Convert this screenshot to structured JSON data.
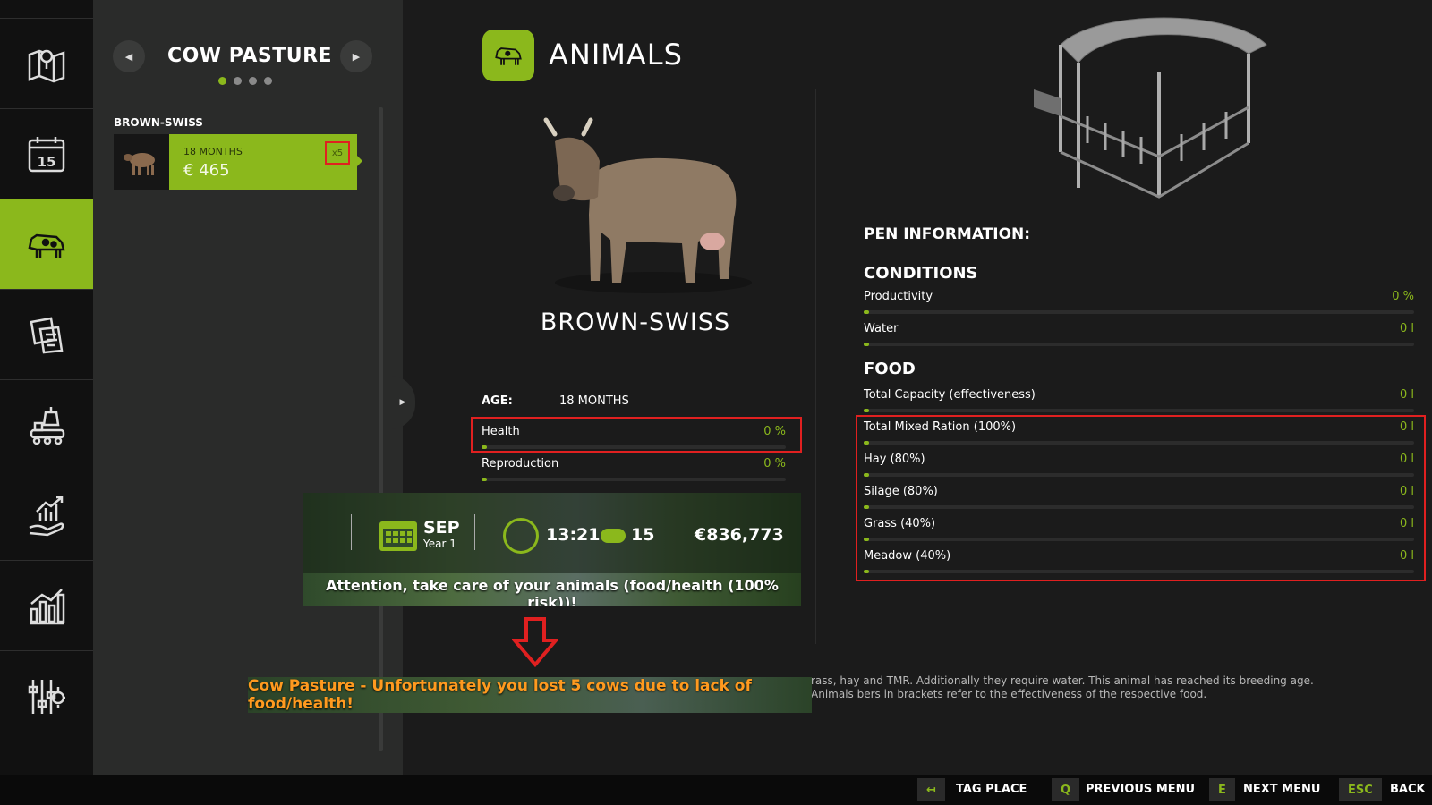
{
  "sidebar": {
    "items": [
      {
        "icon": "map-icon"
      },
      {
        "icon": "calendar-icon",
        "text": "15"
      },
      {
        "icon": "cow-icon",
        "active": true
      },
      {
        "icon": "contracts-icon"
      },
      {
        "icon": "production-icon"
      },
      {
        "icon": "finance-icon"
      },
      {
        "icon": "statistics-icon"
      },
      {
        "icon": "settings-icon"
      }
    ]
  },
  "list": {
    "title": "COW PASTURE",
    "page_count": 4,
    "active_page": 1,
    "breed_heading": "BROWN-SWISS",
    "card": {
      "age": "18 MONTHS",
      "price": "€ 465",
      "count": "x5"
    }
  },
  "main": {
    "title": "ANIMALS",
    "breed_name": "BROWN-SWISS",
    "age_label": "AGE:",
    "age_value": "18 MONTHS",
    "stats": [
      {
        "label": "Health",
        "value": "0 %",
        "fraction": 0
      },
      {
        "label": "Reproduction",
        "value": "0 %",
        "fraction": 0
      }
    ],
    "description": "rass, hay and TMR. Additionally they require water. This animal has reached its breeding age. Animals bers in brackets refer to the effectiveness of the respective food."
  },
  "pen": {
    "heading": "PEN INFORMATION:",
    "conditions_heading": "CONDITIONS",
    "conditions": [
      {
        "label": "Productivity",
        "value": "0 %",
        "fraction": 0
      },
      {
        "label": "Water",
        "value": "0 l",
        "fraction": 0
      }
    ],
    "food_heading": "FOOD",
    "food": [
      {
        "label": "Total Capacity (effectiveness)",
        "value": "0 l",
        "fraction": 0
      },
      {
        "label": "Total Mixed Ration (100%)",
        "value": "0 l",
        "fraction": 0
      },
      {
        "label": "Hay (80%)",
        "value": "0 l",
        "fraction": 0
      },
      {
        "label": "Silage (80%)",
        "value": "0 l",
        "fraction": 0
      },
      {
        "label": "Grass (40%)",
        "value": "0 l",
        "fraction": 0
      },
      {
        "label": "Meadow (40%)",
        "value": "0 l",
        "fraction": 0
      }
    ]
  },
  "hud": {
    "month": "SEP",
    "year": "Year 1",
    "time": "13:21",
    "speed": "15",
    "money": "€836,773",
    "warning": "Attention, take care of your animals (food/health (100% risk))!"
  },
  "loss_banner": "Cow Pasture - Unfortunately you lost 5 cows due to lack of food/health!",
  "footer": {
    "tag_key": "↤",
    "tag_label": "TAG PLACE",
    "prev_key": "Q",
    "prev_label": "PREVIOUS MENU",
    "next_key": "E",
    "next_label": "NEXT MENU",
    "back_key": "ESC",
    "back_label": "BACK"
  },
  "colors": {
    "accent": "#8bb81c",
    "alert": "#e02020",
    "warning_text": "#ff9a1f"
  }
}
